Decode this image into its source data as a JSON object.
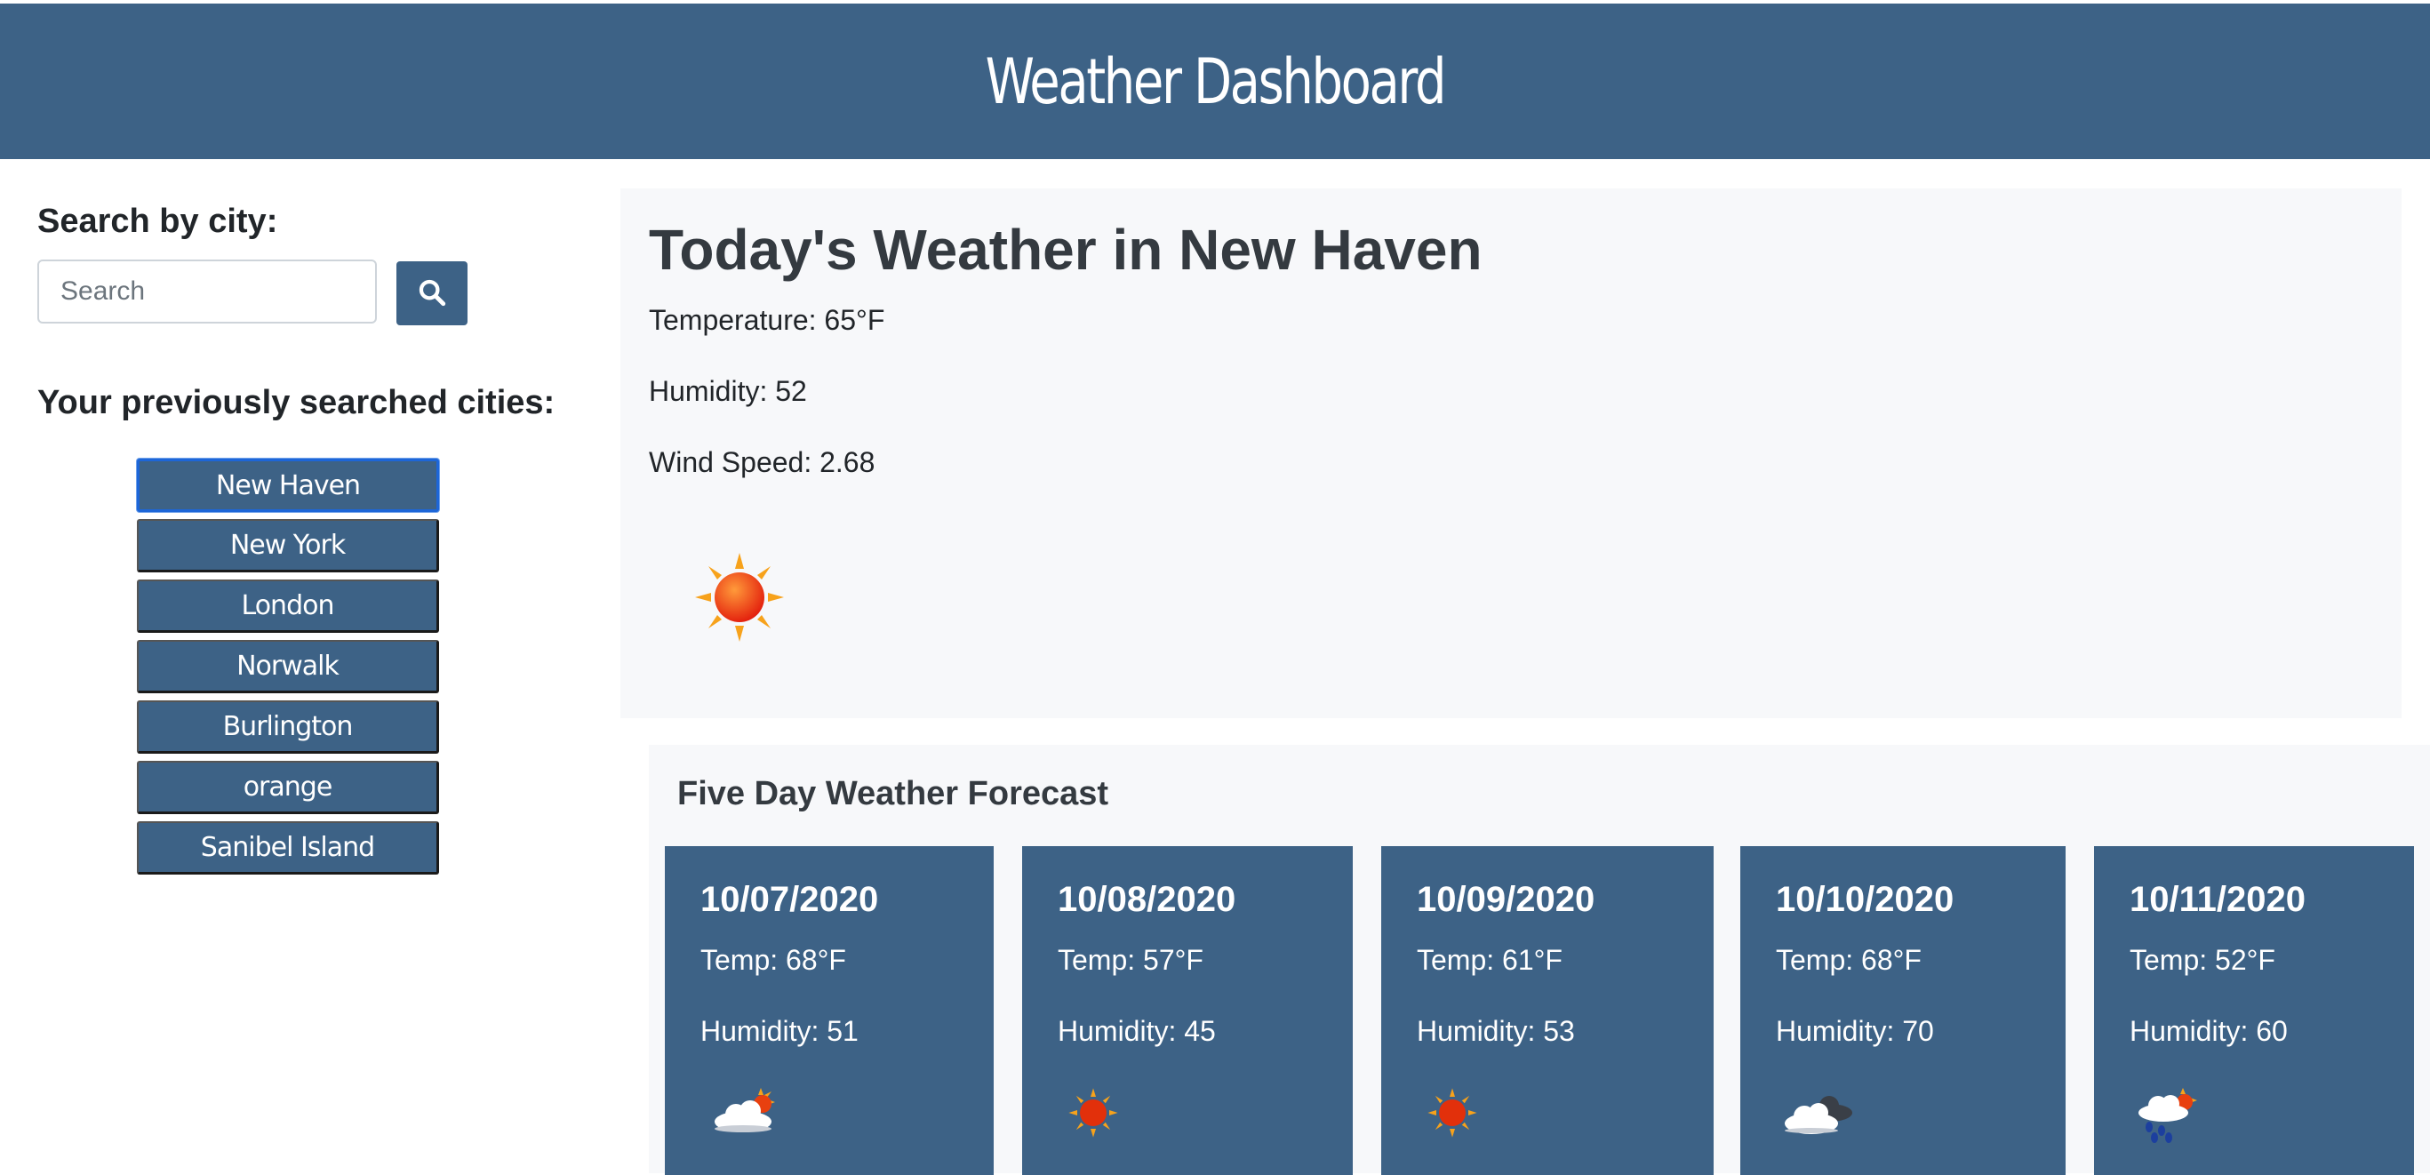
{
  "header": {
    "title": "Weather Dashboard"
  },
  "sidebar": {
    "search_label": "Search by city:",
    "search_placeholder": "Search",
    "search_value": "",
    "search_button_icon": "search-icon",
    "previous_label": "Your previously searched cities:",
    "cities": [
      "New Haven",
      "New York",
      "London",
      "Norwalk",
      "Burlington",
      "orange",
      "Sanibel Island"
    ],
    "active_city": "New Haven"
  },
  "today": {
    "title": "Today's Weather in New Haven",
    "temperature": "Temperature: 65°F",
    "humidity": "Humidity: 52",
    "wind_speed": "Wind Speed: 2.68",
    "icon": "sun-icon"
  },
  "forecast": {
    "title": "Five Day Weather Forecast",
    "days": [
      {
        "date": "10/07/2020",
        "temp": "Temp: 68°F",
        "humidity": "Humidity: 51",
        "icon": "partly-cloudy-icon"
      },
      {
        "date": "10/08/2020",
        "temp": "Temp: 57°F",
        "humidity": "Humidity: 45",
        "icon": "sun-icon"
      },
      {
        "date": "10/09/2020",
        "temp": "Temp: 61°F",
        "humidity": "Humidity: 53",
        "icon": "sun-icon"
      },
      {
        "date": "10/10/2020",
        "temp": "Temp: 68°F",
        "humidity": "Humidity: 70",
        "icon": "cloudy-icon"
      },
      {
        "date": "10/11/2020",
        "temp": "Temp: 52°F",
        "humidity": "Humidity: 60",
        "icon": "rain-icon"
      }
    ]
  },
  "colors": {
    "accent": "#3d6286",
    "panel_bg": "#f7f8fa",
    "active_border": "#1d66d8"
  }
}
